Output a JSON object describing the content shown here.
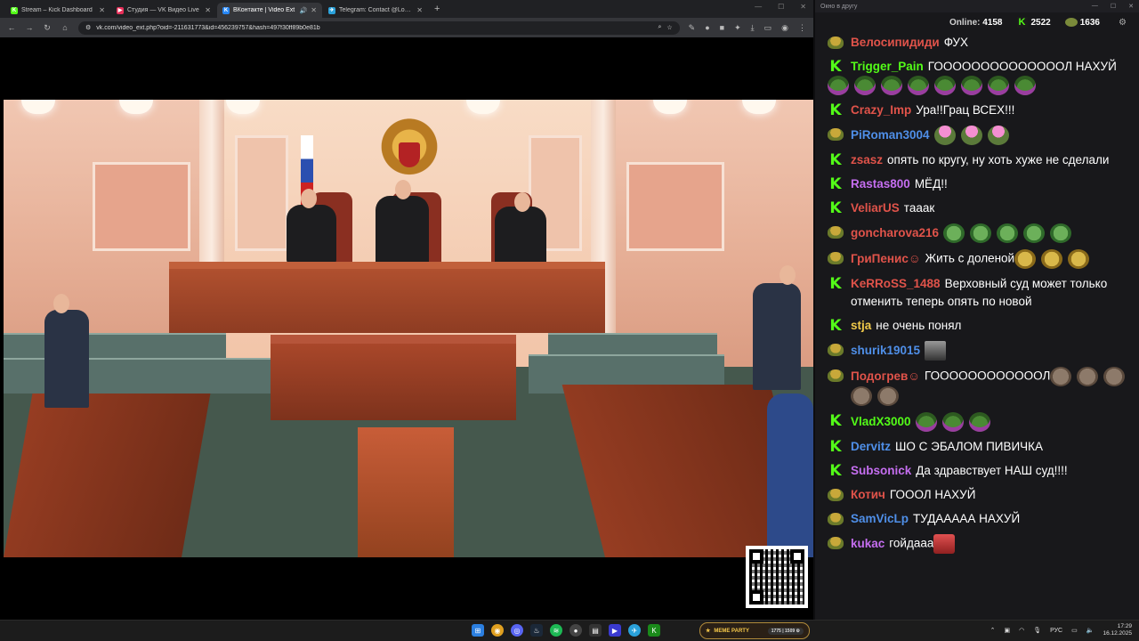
{
  "browser": {
    "tabs": [
      {
        "title": "Stream – Kick Dashboard",
        "color": "#53fc18",
        "glyph": "K"
      },
      {
        "title": "Студия — VK Видео Live",
        "color": "#e8305a",
        "glyph": "▶"
      },
      {
        "title": "ВКонтакте | Video Ext",
        "color": "#2787f5",
        "glyph": "K",
        "active": true
      },
      {
        "title": "Telegram: Contact @Love_Russia",
        "color": "#2aa1da",
        "glyph": "✈"
      }
    ],
    "new_tab": "+",
    "url": "vk.com/video_ext.php?oid=-211631773&id=456239757&hash=497f30ff89b0e81b"
  },
  "chat": {
    "window_title": "Окно в другу",
    "online_label": "Online:",
    "online_value": "4158",
    "kick_count": "2522",
    "other_count": "1636",
    "messages": [
      {
        "badge": "t",
        "user": "Велосипидиди",
        "color": "#e0534a",
        "text": "ФУХ",
        "emotes": []
      },
      {
        "badge": "k",
        "user": "Trigger_Pain",
        "color": "#53fc18",
        "text": "ГООООООООООООООЛ НАХУЙ",
        "emotes": [
          "pepe",
          "pepe",
          "pepe",
          "pepe",
          "pepe",
          "pepe",
          "pepe",
          "pepe"
        ],
        "emote_block": true
      },
      {
        "badge": "k",
        "user": "Crazy_Imp",
        "color": "#e0534a",
        "text": "Ура!!Грац ВСЕХ!!!",
        "emotes": []
      },
      {
        "badge": "t",
        "user": "PiRoman3004",
        "color": "#4f8fe8",
        "text": "",
        "emotes": [
          "pink",
          "pink",
          "pink"
        ]
      },
      {
        "badge": "k",
        "user": "zsasz",
        "color": "#e0534a",
        "text": "опять по кругу, ну хоть хуже не сделали",
        "emotes": []
      },
      {
        "badge": "k",
        "user": "Rastas800",
        "color": "#c56ef0",
        "text": "МЁД!!",
        "emotes": []
      },
      {
        "badge": "k",
        "user": "VeliarUS",
        "color": "#e0534a",
        "text": "тааак",
        "emotes": []
      },
      {
        "badge": "t",
        "user": "goncharova216",
        "color": "#e0534a",
        "text": "",
        "emotes": [
          "frog",
          "frog",
          "frog",
          "frog",
          "frog"
        ]
      },
      {
        "badge": "t",
        "user": "ГриПенис☺",
        "color": "#e0534a",
        "text": "Жить с доленой",
        "emotes": [
          "gold",
          "gold",
          "gold"
        ]
      },
      {
        "badge": "k",
        "user": "KeRRoSS_1488",
        "color": "#e0534a",
        "text": "Верховный суд может только отменить теперь опять по новой",
        "emotes": []
      },
      {
        "badge": "k",
        "user": "stja",
        "color": "#f0c94a",
        "text": "не очень понял",
        "emotes": []
      },
      {
        "badge": "t",
        "user": "shurik19015",
        "color": "#4f8fe8",
        "text": "",
        "emotes": [
          "photo"
        ]
      },
      {
        "badge": "t",
        "user": "Подогрев☺",
        "color": "#e0534a",
        "text": "ГООООООООООООЛ",
        "emotes": [
          "mole",
          "mole",
          "mole",
          "mole",
          "mole"
        ]
      },
      {
        "badge": "k",
        "user": "VladX3000",
        "color": "#53fc18",
        "text": "",
        "emotes": [
          "pepe",
          "pepe",
          "pepe"
        ]
      },
      {
        "badge": "k",
        "user": "Dervitz",
        "color": "#4f8fe8",
        "text": "ШО С ЭБАЛОМ ПИВИЧКА",
        "emotes": []
      },
      {
        "badge": "k",
        "user": "Subsonick",
        "color": "#c56ef0",
        "text": "Да здравствует НАШ суд!!!!",
        "emotes": []
      },
      {
        "badge": "t",
        "user": "Котич",
        "color": "#e0534a",
        "text": "ГОООЛ НАХУЙ",
        "emotes": []
      },
      {
        "badge": "t",
        "user": "SamVicLp",
        "color": "#4f8fe8",
        "text": "ТУДААААА НАХУЙ",
        "emotes": []
      },
      {
        "badge": "t",
        "user": "kukac",
        "color": "#c56ef0",
        "text": "гойдааа",
        "emotes": [
          "red"
        ]
      }
    ]
  },
  "taskbar": {
    "meme_label": "MEME PARTY",
    "meme_stats": "1775 | 1509 ⚙",
    "lang": "РУС",
    "time": "17:29",
    "date": "16.12.2025"
  }
}
